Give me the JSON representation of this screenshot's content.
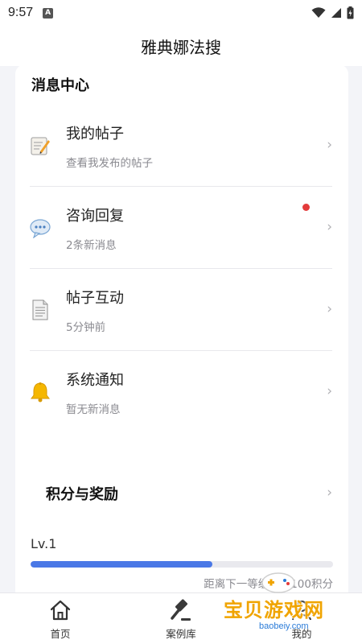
{
  "status_bar": {
    "time": "9:57"
  },
  "header": {
    "title": "雅典娜法搜"
  },
  "message_center": {
    "title": "消息中心",
    "items": [
      {
        "title": "我的帖子",
        "subtitle": "查看我发布的帖子",
        "icon": "memo-icon",
        "chevron": "›"
      },
      {
        "title": "咨询回复",
        "subtitle": "2条新消息",
        "icon": "speech-bubble-icon",
        "chevron": "›",
        "unread": true
      },
      {
        "title": "帖子互动",
        "subtitle": "5分钟前",
        "icon": "document-icon",
        "chevron": "›"
      },
      {
        "title": "系统通知",
        "subtitle": "暂无新消息",
        "icon": "bell-icon",
        "chevron": "›"
      }
    ]
  },
  "rewards": {
    "title": "积分与奖励",
    "chevron": "›",
    "level": "Lv.1",
    "progress": 0.6,
    "hint": "距离下一等级还需100积分"
  },
  "tabbar": {
    "tabs": [
      {
        "label": "首页",
        "icon": "home-icon"
      },
      {
        "label": "案例库",
        "icon": "gavel-icon"
      },
      {
        "label": "我的",
        "icon": "user-icon"
      }
    ]
  },
  "watermark": {
    "text": "宝贝游戏网",
    "url": "baobeiy.com"
  },
  "colors": {
    "accent": "#4a78e6",
    "unread_dot": "#e33b3b",
    "watermark": "#f0a400"
  }
}
